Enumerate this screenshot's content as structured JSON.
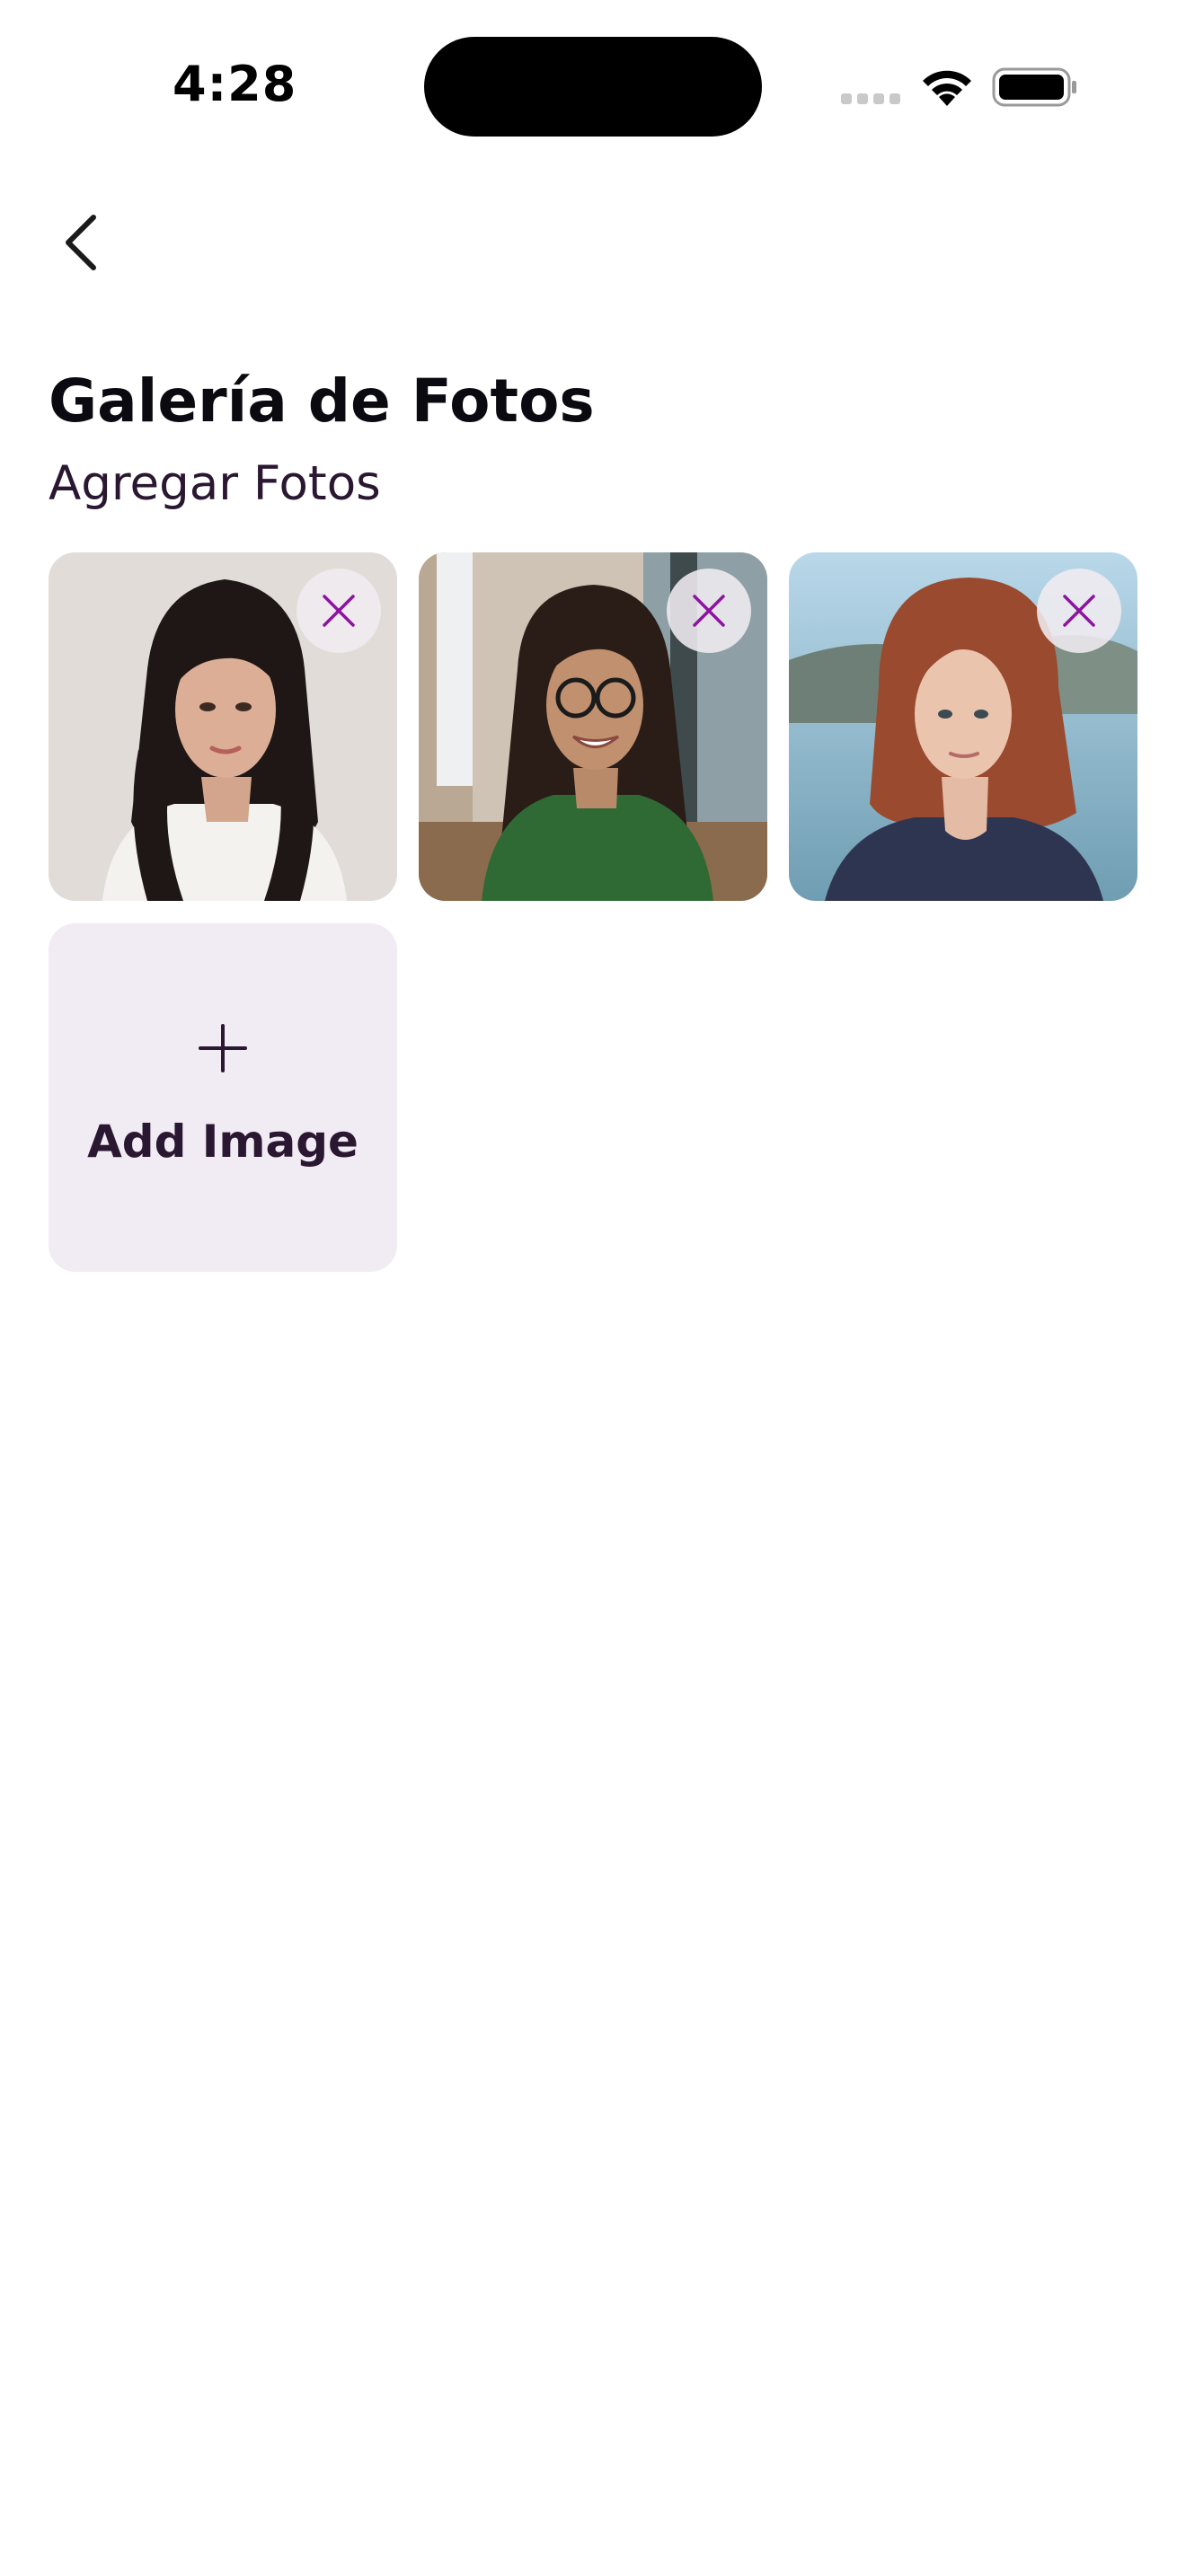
{
  "status_bar": {
    "time": "4:28"
  },
  "header": {
    "back_icon": "chevron-left-icon",
    "title": "Galería de Fotos",
    "subtitle": "Agregar Fotos"
  },
  "gallery": {
    "photos": [
      {
        "name": "photo-1",
        "remove_icon": "close-icon"
      },
      {
        "name": "photo-2",
        "remove_icon": "close-icon"
      },
      {
        "name": "photo-3",
        "remove_icon": "close-icon"
      }
    ],
    "add_tile": {
      "icon": "plus-icon",
      "label": "Add Image"
    }
  },
  "colors": {
    "accent": "#8c14a0",
    "text_primary": "#0b0a10",
    "text_secondary": "#2a1731",
    "add_tile_bg": "#f1ebf3"
  }
}
